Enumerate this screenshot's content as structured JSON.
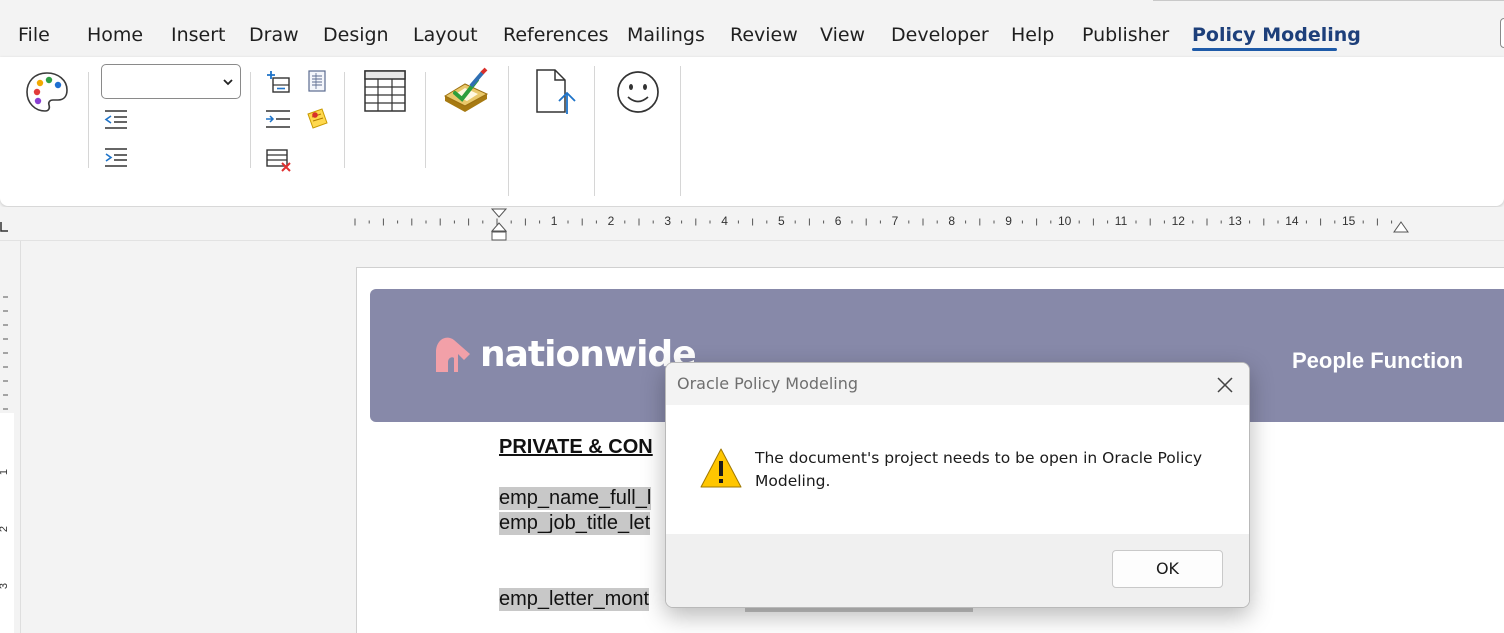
{
  "menu": {
    "tabs": [
      "File",
      "Home",
      "Insert",
      "Draw",
      "Design",
      "Layout",
      "References",
      "Mailings",
      "Review",
      "View",
      "Developer",
      "Help",
      "Publisher",
      "Policy Modeling"
    ],
    "active_tab": "Policy Modeling"
  },
  "ribbon": {
    "style_dropdown_value": "",
    "icons": [
      "palette-icon",
      "decrease-indent-icon",
      "increase-indent-icon",
      "insert-row-icon",
      "indent-icon",
      "delete-row-icon",
      "document-list-icon",
      "sticky-note-icon",
      "table-icon",
      "validate-checkmark-icon",
      "upload-document-icon",
      "smiley-icon"
    ]
  },
  "ruler": {
    "numbers": [
      "1",
      "2",
      "3",
      "4",
      "5",
      "6",
      "7",
      "8",
      "9",
      "10",
      "11",
      "12",
      "13",
      "14",
      "15"
    ],
    "vertical_numbers": [
      "1",
      "2",
      "3"
    ]
  },
  "document": {
    "logo_text": "nationwide",
    "banner_right": "People Function",
    "heading": "PRIVATE & CON",
    "line1": "emp_name_full_l",
    "line2": "emp_job_title_let",
    "line3": "emp_letter_mont"
  },
  "dialog": {
    "title": "Oracle Policy Modeling",
    "message": "The document's project needs to be open in Oracle Policy Modeling.",
    "ok_label": "OK"
  },
  "colors": {
    "banner": "#8789a9",
    "active_tab": "#1d3f7a",
    "tab_underline": "#1e5aa8",
    "logo_mark": "#f2a0a8",
    "warning": "#ffc600"
  }
}
